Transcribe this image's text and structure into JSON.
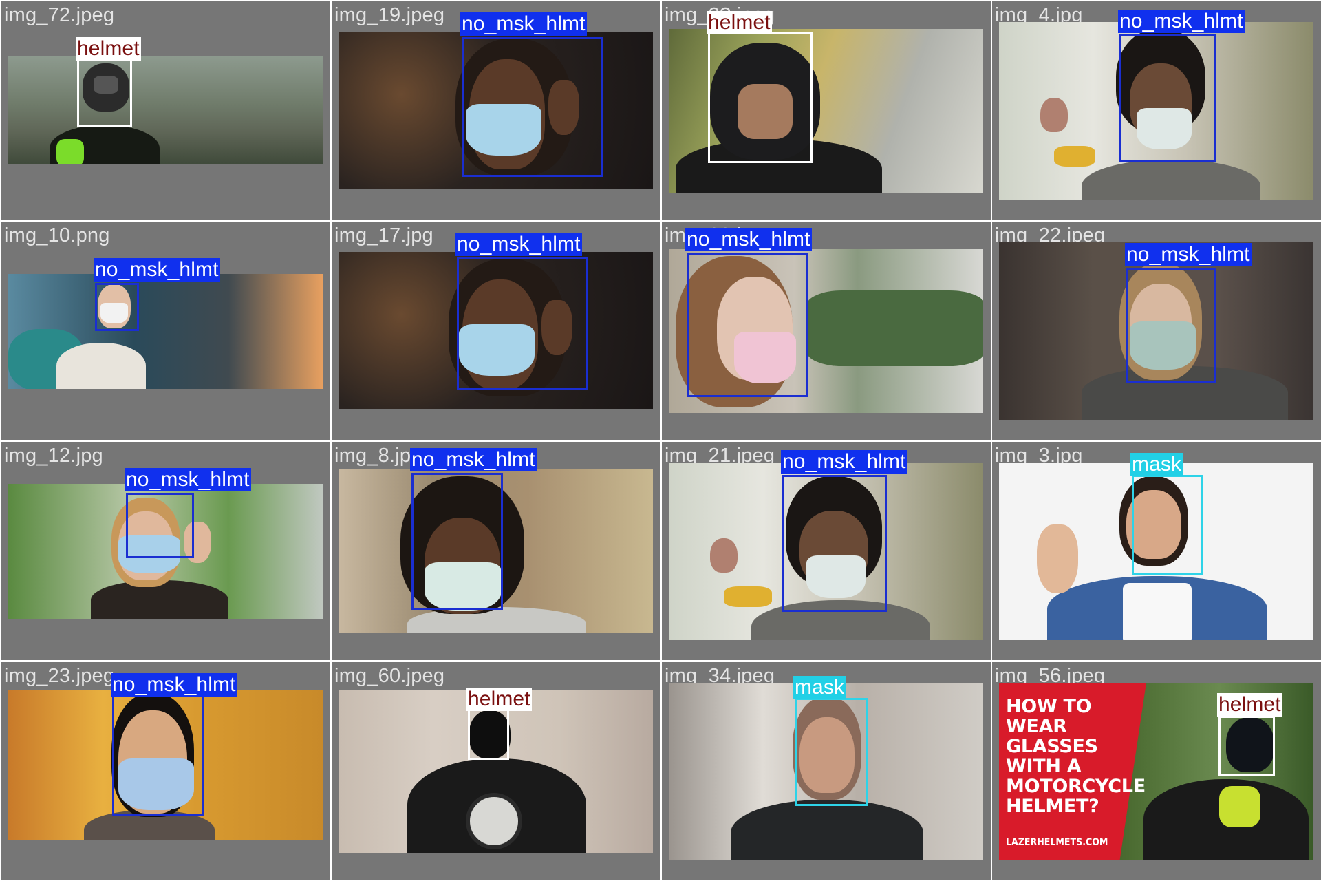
{
  "colors": {
    "tile_background": "#767676",
    "filename_text": "#e4e4e4",
    "helmet_box": "#ffffff",
    "helmet_tag_text": "#7a0f0f",
    "no_mask_helmet_box": "#1a2ed1",
    "no_mask_helmet_tag_bg": "#1030ee",
    "mask_box": "#2ed3e8",
    "mask_tag_bg": "#22d0e6",
    "tag_light_text": "#ffffff"
  },
  "label_names": {
    "helmet": "helmet",
    "no_mask_helmet": "no_msk_hlmt",
    "mask": "mask"
  },
  "tiles": [
    {
      "filename": "img_72.jpeg",
      "scene": "motorcyclist in full-face helmet on a hazy hillside road",
      "detections": [
        "helmet"
      ]
    },
    {
      "filename": "img_19.jpeg",
      "scene": "woman adjusting a blue surgical mask",
      "detections": [
        "no_msk_hlmt"
      ]
    },
    {
      "filename": "img_2?.jpeg",
      "scene": "rider in black modular helmet with autumn trees behind",
      "detections": [
        "helmet"
      ]
    },
    {
      "filename": "img_4.jpg",
      "scene": "woman with earbuds wearing a mask on a tram",
      "detections": [
        "no_msk_hlmt"
      ]
    },
    {
      "filename": "img_10.png",
      "scene": "traveller with backpack wearing a white mask",
      "detections": [
        "no_msk_hlmt"
      ]
    },
    {
      "filename": "img_17.jpg",
      "scene": "woman adjusting a blue surgical mask",
      "detections": [
        "no_msk_hlmt"
      ]
    },
    {
      "filename": "img_??.jpg",
      "scene": "woman wearing a pink cloth mask outdoors",
      "detections": [
        "no_msk_hlmt"
      ]
    },
    {
      "filename": "img_22.jpeg",
      "scene": "girl wearing a pale green cloth mask",
      "detections": [
        "no_msk_hlmt"
      ]
    },
    {
      "filename": "img_12.jpg",
      "scene": "woman putting on a blue mask in a street",
      "detections": [
        "no_msk_hlmt"
      ]
    },
    {
      "filename": "img_8.jpg",
      "scene": "woman wearing a light surgical mask indoors",
      "detections": [
        "no_msk_hlmt"
      ]
    },
    {
      "filename": "img_21.jpeg",
      "scene": "woman with earbuds wearing a mask on a tram",
      "detections": [
        "no_msk_hlmt"
      ]
    },
    {
      "filename": "img_3.jpg",
      "scene": "smiling bearded man in denim shirt waving",
      "detections": [
        "mask"
      ]
    },
    {
      "filename": "img_23.jpeg",
      "scene": "man wearing a blue mask in autumn park",
      "detections": [
        "no_msk_hlmt"
      ]
    },
    {
      "filename": "img_60.jpeg",
      "scene": "motorcyclist in black helmet riding toward camera",
      "detections": [
        "helmet"
      ]
    },
    {
      "filename": "img_34.jpeg",
      "scene": "smiling bearded man in blurred room",
      "detections": [
        "mask"
      ]
    },
    {
      "filename": "img_56.jpeg",
      "scene": "motorcycle helmet advert with rider",
      "detections": [
        "helmet"
      ],
      "promo_title": "HOW TO\nWEAR\nGLASSES\nWITH A\nMOTORCYCLE\nHELMET?",
      "promo_site": "LAZERHELMETS.COM"
    }
  ]
}
